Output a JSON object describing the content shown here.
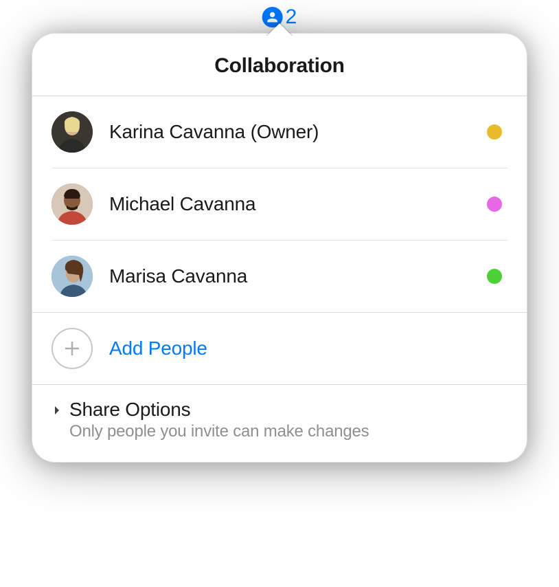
{
  "trigger": {
    "count": "2",
    "icon_name": "person-silhouette-icon"
  },
  "popover": {
    "title": "Collaboration"
  },
  "collaborators": [
    {
      "name": "Karina Cavanna (Owner)",
      "status_color": "#E8BA2C"
    },
    {
      "name": "Michael Cavanna",
      "status_color": "#E768E2"
    },
    {
      "name": "Marisa Cavanna",
      "status_color": "#4CD136"
    }
  ],
  "add_people": {
    "label": "Add People"
  },
  "share_options": {
    "title": "Share Options",
    "subtitle": "Only people you invite can make changes"
  }
}
